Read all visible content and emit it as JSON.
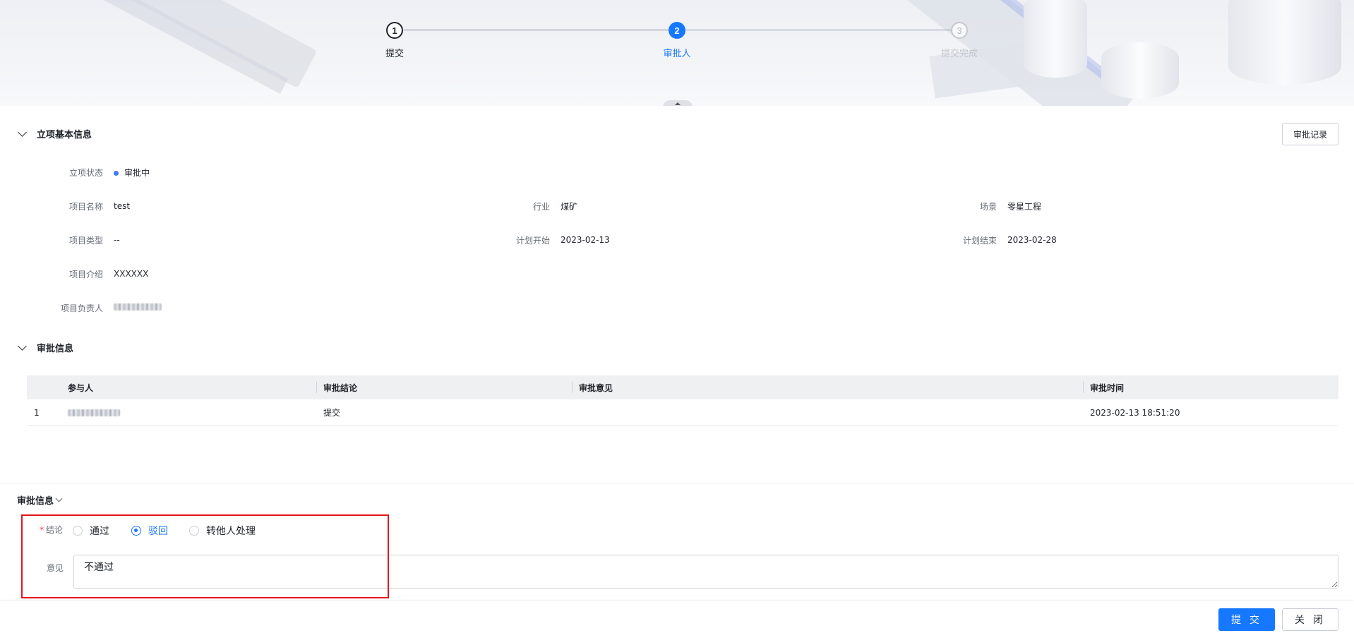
{
  "steps": [
    {
      "number": "1",
      "label": "提交",
      "state": "done"
    },
    {
      "number": "2",
      "label": "审批人",
      "state": "active"
    },
    {
      "number": "3",
      "label": "提交完成",
      "state": "pending"
    }
  ],
  "basic_info": {
    "title": "立项基本信息",
    "record_button": "审批记录",
    "status_label": "立项状态",
    "status_value": "审批中",
    "fields": {
      "name": {
        "label": "项目名称",
        "value": "test"
      },
      "industry": {
        "label": "行业",
        "value": "煤矿"
      },
      "scene": {
        "label": "场景",
        "value": "零星工程"
      },
      "type": {
        "label": "项目类型",
        "value": "--"
      },
      "plan_start": {
        "label": "计划开始",
        "value": "2023-02-13"
      },
      "plan_end": {
        "label": "计划结束",
        "value": "2023-02-28"
      },
      "intro": {
        "label": "项目介绍",
        "value": "XXXXXX"
      },
      "owner": {
        "label": "项目负责人"
      }
    }
  },
  "approval_info": {
    "title": "审批信息",
    "columns": [
      "参与人",
      "审批结论",
      "审批意见",
      "审批时间"
    ],
    "rows": [
      {
        "index": "1",
        "conclusion": "提交",
        "opinion": "",
        "time": "2023-02-13 18:51:20"
      }
    ]
  },
  "approval_form": {
    "title": "审批信息",
    "conclusion_label": "结论",
    "options": [
      "通过",
      "驳回",
      "转他人处理"
    ],
    "selected": "驳回",
    "opinion_label": "意见",
    "opinion_value": "不通过"
  },
  "footer": {
    "submit": "提 交",
    "close": "关 闭"
  },
  "colors": {
    "primary": "#1677ff",
    "highlight_border": "#e8141b",
    "status_dot": "#3e7bfa"
  }
}
